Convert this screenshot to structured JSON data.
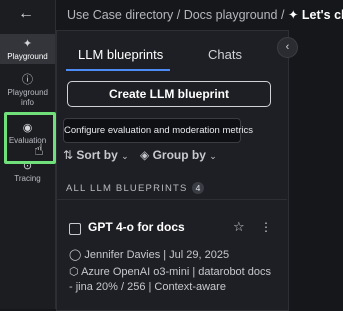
{
  "rail": {
    "back_icon": "arrow-left-icon",
    "items": [
      {
        "label": "Playground",
        "icon": "sparkle-icon"
      },
      {
        "label": "Playground info",
        "icon": "info-circle-icon"
      },
      {
        "label": "Evaluation",
        "icon": "target-icon"
      },
      {
        "label": "Tracing",
        "icon": "trace-icon"
      }
    ]
  },
  "breadcrumb": {
    "path": "Use Case directory / Docs playground /",
    "current": "Let's chat"
  },
  "tabs": [
    {
      "label": "LLM blueprints",
      "active": true
    },
    {
      "label": "Chats",
      "active": false
    }
  ],
  "create_button": "Create LLM blueprint",
  "tooltip": "Configure evaluation and moderation metrics",
  "sort_label": "Sort by",
  "group_label": "Group by",
  "section": {
    "title": "ALL LLM BLUEPRINTS",
    "count": "4"
  },
  "card": {
    "title": "GPT 4-o for docs",
    "meta_line": "Jennifer Davies | Jul 29, 2025",
    "details_line1": "Azure OpenAI o3-mini | datarobot docs",
    "details_line2": "- jina 20% / 256 | Context-aware"
  },
  "colors": {
    "accent": "#4d8cf5",
    "highlight": "#6fe07a"
  }
}
